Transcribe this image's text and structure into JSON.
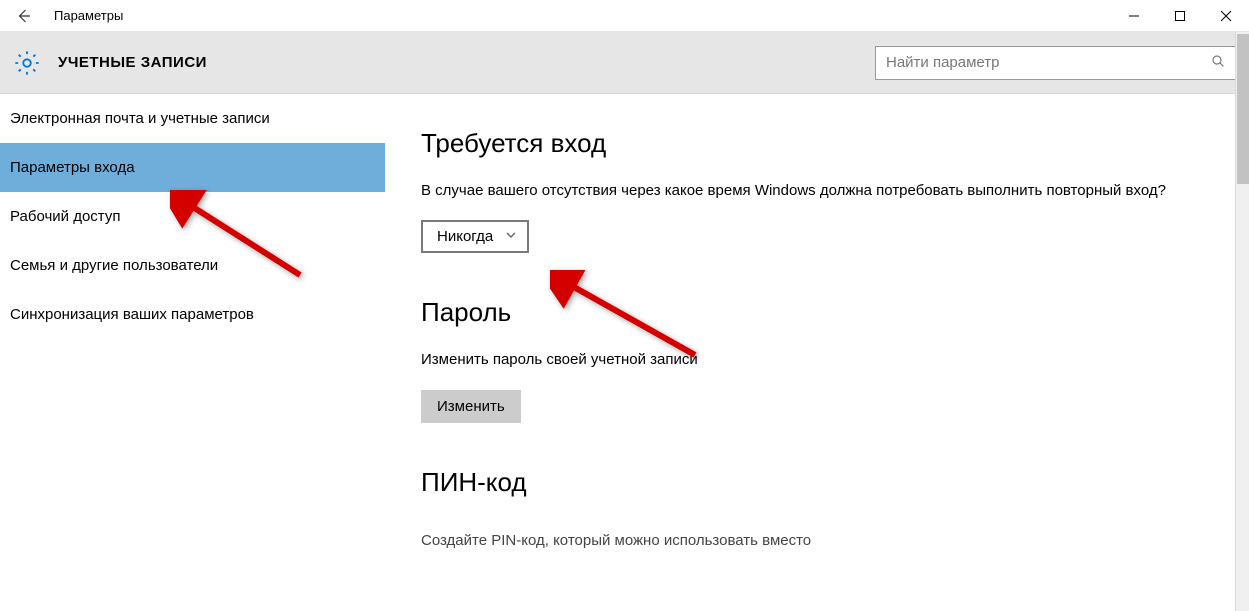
{
  "window": {
    "title": "Параметры"
  },
  "header": {
    "title": "УЧЕТНЫЕ ЗАПИСИ",
    "search_placeholder": "Найти параметр"
  },
  "sidebar": {
    "items": [
      {
        "label": "Электронная почта и учетные записи",
        "selected": false
      },
      {
        "label": "Параметры входа",
        "selected": true
      },
      {
        "label": "Рабочий доступ",
        "selected": false
      },
      {
        "label": "Семья и другие пользователи",
        "selected": false
      },
      {
        "label": "Синхронизация ваших параметров",
        "selected": false
      }
    ]
  },
  "main": {
    "require_signin": {
      "heading": "Требуется вход",
      "desc": "В случае вашего отсутствия через какое время Windows должна потребовать выполнить повторный вход?",
      "combo_value": "Никогда"
    },
    "password": {
      "heading": "Пароль",
      "desc": "Изменить пароль своей учетной записи",
      "button": "Изменить"
    },
    "pin": {
      "heading": "ПИН-код",
      "cutoff_text": "Создайте PIN-код, который можно использовать вместо"
    }
  }
}
